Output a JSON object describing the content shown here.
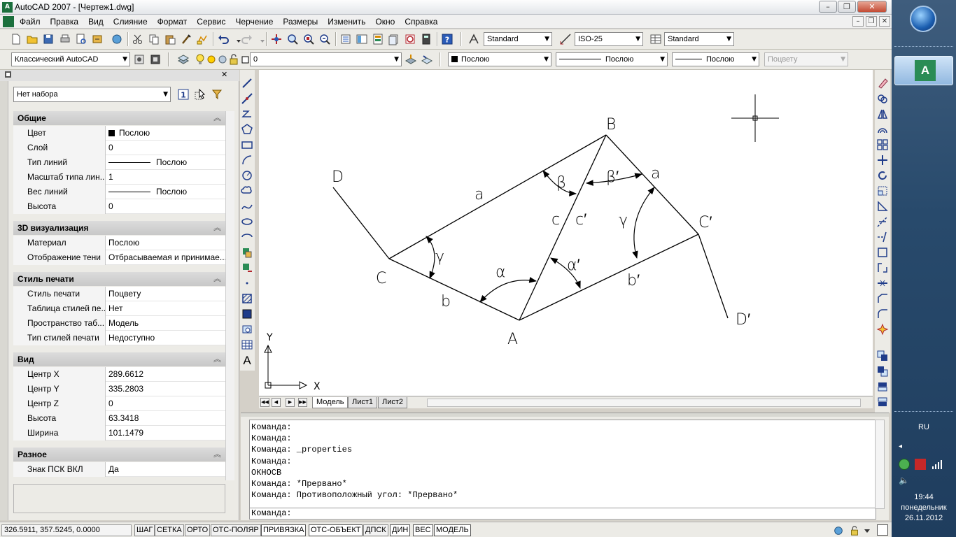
{
  "window": {
    "title": "AutoCAD 2007 - [Чертеж1.dwg]",
    "minimize_glyph": "–",
    "restore_glyph": "❐",
    "close_glyph": "✕"
  },
  "menu": {
    "items": [
      "Файл",
      "Правка",
      "Вид",
      "Слияние",
      "Формат",
      "Сервис",
      "Черчение",
      "Размеры",
      "Изменить",
      "Окно",
      "Справка"
    ],
    "mdi_minimize": "–",
    "mdi_restore": "❐",
    "mdi_close": "✕"
  },
  "toolbar1": {
    "text_style": "Standard",
    "dim_style": "ISO-25",
    "table_style": "Standard"
  },
  "toolbar2": {
    "workspace": "Классический AutoCAD",
    "layer": "0",
    "color": "Послою",
    "linetype": "Послою",
    "lineweight": "Послою",
    "plotstyle": "Поцвету"
  },
  "palette": {
    "selection": "Нет набора",
    "categories": {
      "general": "Общие",
      "viz3d": "3D визуализация",
      "plot": "Стиль печати",
      "view": "Вид",
      "misc": "Разное"
    },
    "general": [
      {
        "key": "Цвет",
        "value": "Послою"
      },
      {
        "key": "Слой",
        "value": "0"
      },
      {
        "key": "Тип линий",
        "value": "Послою"
      },
      {
        "key": "Масштаб типа лин...",
        "value": "1"
      },
      {
        "key": "Вес линий",
        "value": "Послою"
      },
      {
        "key": "Высота",
        "value": "0"
      }
    ],
    "viz3d": [
      {
        "key": "Материал",
        "value": "Послою"
      },
      {
        "key": "Отображение тени",
        "value": "Отбрасываемая и принимае..."
      }
    ],
    "plot": [
      {
        "key": "Стиль печати",
        "value": "Поцвету"
      },
      {
        "key": "Таблица стилей пе...",
        "value": "Нет"
      },
      {
        "key": "Пространство таб...",
        "value": "Модель"
      },
      {
        "key": "Тип стилей печати",
        "value": "Недоступно"
      }
    ],
    "view": [
      {
        "key": "Центр X",
        "value": "289.6612"
      },
      {
        "key": "Центр Y",
        "value": "335.2803"
      },
      {
        "key": "Центр Z",
        "value": "0"
      },
      {
        "key": "Высота",
        "value": "63.3418"
      },
      {
        "key": "Ширина",
        "value": "101.1479"
      }
    ],
    "misc": [
      {
        "key": "Знак ПСК ВКЛ",
        "value": "Да"
      }
    ]
  },
  "drawing": {
    "labels": {
      "B": "B",
      "D": "D",
      "C": "C",
      "A": "A",
      "Cp": "C′",
      "Dp": "D′",
      "a": "a",
      "b": "b",
      "c": "c",
      "cp": "c′",
      "ap": "a",
      "bp": "b′",
      "beta": "β",
      "betap": "β′",
      "gamma": "γ",
      "gammap": "γ",
      "alpha": "α",
      "alphap": "α′"
    },
    "ucs_x": "X",
    "ucs_y": "Y"
  },
  "tabs": {
    "nav": [
      "◀◀",
      "◀",
      "▶",
      "▶▶"
    ],
    "items": [
      "Модель",
      "Лист1",
      "Лист2"
    ],
    "active": 0
  },
  "command": {
    "history": [
      "Команда:",
      "Команда:",
      "Команда: _properties",
      "Команда:",
      "ОКНОСВ",
      "Команда: *Прервано*",
      "Команда: Противоположный угол: *Прервано*"
    ],
    "prompt": "Команда:"
  },
  "status": {
    "coords": "326.5911, 357.5245, 0.0000",
    "buttons": [
      "ШАГ",
      "СЕТКА",
      "ОРТО",
      "ОТС-ПОЛЯР",
      "ПРИВЯЗКА",
      "ОТС-ОБЪЕКТ",
      "ДПСК",
      "ДИН",
      "ВЕС",
      "МОДЕЛЬ"
    ],
    "on": [
      "ПРИВЯЗКА",
      "ОТС-ОБЪЕКТ",
      "ДИН",
      "ВЕС",
      "МОДЕЛЬ"
    ]
  },
  "taskbar": {
    "lang": "RU",
    "time": "19:44",
    "day": "понедельник",
    "date": "26.11.2012",
    "app_label": "A"
  },
  "colors": {
    "accent": "#1b6f3d",
    "taskbar": "#284a6c"
  }
}
